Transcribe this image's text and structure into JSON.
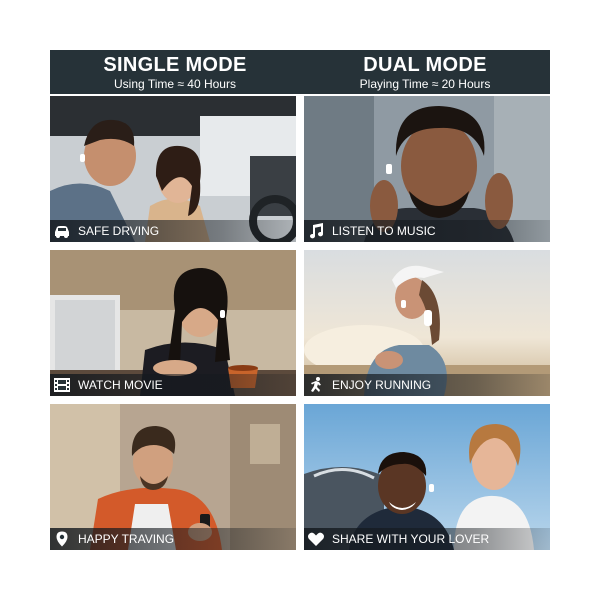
{
  "header": {
    "single": {
      "title": "SINGLE MODE",
      "subtitle": "Using Time ≈ 40 Hours"
    },
    "dual": {
      "title": "DUAL MODE",
      "subtitle": "Playing Time ≈ 20 Hours"
    }
  },
  "tiles": [
    {
      "caption": "SAFE DRVING",
      "icon": "car-icon"
    },
    {
      "caption": "LISTEN TO MUSIC",
      "icon": "music-note-icon"
    },
    {
      "caption": "WATCH MOVIE",
      "icon": "film-icon"
    },
    {
      "caption": "ENJOY RUNNING",
      "icon": "running-person-icon"
    },
    {
      "caption": "HAPPY TRAVING",
      "icon": "location-pin-icon"
    },
    {
      "caption": "SHARE WITH YOUR LOVER",
      "icon": "heart-icon"
    }
  ],
  "colors": {
    "header_background": "#263238",
    "header_text": "#ffffff",
    "caption_text": "#ffffff"
  }
}
